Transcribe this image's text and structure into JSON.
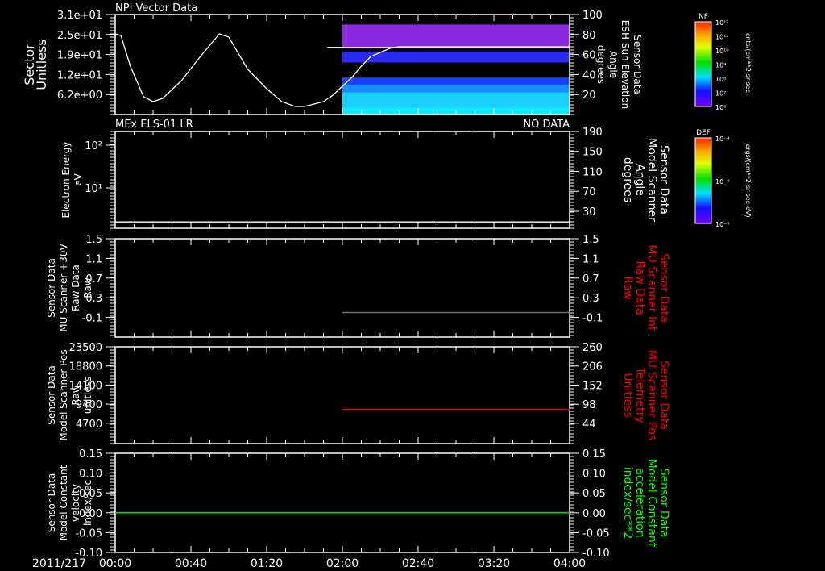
{
  "colors": {
    "background": "#000000",
    "axes": "#ffffff",
    "red_label": "#ff0000",
    "green_label": "#00ff00"
  },
  "time_axis": {
    "date_label": "2011/217",
    "ticks": [
      "00:00",
      "00:40",
      "01:20",
      "02:00",
      "02:40",
      "03:20",
      "04:00"
    ],
    "minutes": [
      0,
      40,
      80,
      120,
      160,
      200,
      240
    ]
  },
  "chart_data": [
    {
      "type": "line",
      "title": "NPI Vector Data",
      "ylabel_lines": [
        "Sector",
        "Unitless"
      ],
      "ylim": [
        0,
        31
      ],
      "yticks": [
        6.2,
        12.4,
        18.6,
        24.8,
        31
      ],
      "ytick_labels": [
        "6.2e+00",
        "1.2e+01",
        "1.9e+01",
        "2.5e+01",
        "3.1e+01"
      ],
      "series": [
        {
          "color": "#ffffff",
          "x_minutes": [
            0,
            3,
            8,
            15,
            20,
            25,
            35,
            45,
            55,
            60,
            70,
            80,
            88,
            95,
            100,
            110,
            115,
            125,
            130,
            135,
            145,
            150,
            240
          ],
          "y": [
            25,
            24.5,
            15,
            5.5,
            4,
            5,
            10.5,
            18,
            25,
            24,
            14,
            8,
            4,
            2.5,
            2.5,
            4,
            6,
            11.5,
            15,
            18,
            20.5,
            21,
            21
          ]
        }
      ],
      "right_axis": {
        "ylabel_lines": [
          "Sensor Data",
          "ESH Sun Elevation",
          "Angle",
          "degrees"
        ],
        "ylim": [
          0,
          100
        ],
        "yticks": [
          20,
          40,
          60,
          80,
          100
        ],
        "ytick_labels": [
          "20",
          "40",
          "60",
          "80",
          "100"
        ]
      },
      "overlay_line": {
        "color": "#ffffff",
        "y_right": 67,
        "start_minutes": 112
      },
      "heatmap": {
        "start_minutes": 120,
        "end_minutes": 240,
        "bands": [
          {
            "from": 66,
            "to": 90,
            "color": "#8a2be2"
          },
          {
            "from": 52,
            "to": 63,
            "color": "#2a2af5"
          },
          {
            "from": 0,
            "to": 37,
            "color": "#1a40ff"
          },
          {
            "from": 0,
            "to": 30,
            "color": "#1a8cff"
          },
          {
            "from": 0,
            "to": 22,
            "color": "#1ad0ff"
          },
          {
            "from": 0,
            "to": 7,
            "color": "#10e8ff"
          }
        ]
      }
    },
    {
      "type": "line",
      "title": "MEx ELS-01 LR",
      "status": "NO DATA",
      "ylabel_lines": [
        "Electron Energy",
        "eV"
      ],
      "yscale": "log",
      "ylim": [
        1.14,
        209
      ],
      "yticks": [
        10,
        100
      ],
      "ytick_labels": [
        "10¹",
        "10²"
      ],
      "series": [
        {
          "color": "#ffffff",
          "x_minutes": [
            0,
            240
          ],
          "y": [
            1.6,
            1.6
          ]
        }
      ],
      "right_axis": {
        "ylabel_lines": [
          "Sensor Data",
          "Model Scanner",
          "Angle",
          "degrees"
        ],
        "ylim": [
          -4,
          190
        ],
        "yticks": [
          30,
          70,
          110,
          150,
          190
        ],
        "ytick_labels": [
          "30",
          "70",
          "110",
          "150",
          "190"
        ]
      }
    },
    {
      "type": "line",
      "ylabel_lines": [
        "Sensor Data",
        "MU Scanner +30V",
        "Raw Data",
        "Raw"
      ],
      "ylim": [
        -0.5,
        1.5
      ],
      "yticks": [
        -0.1,
        0.3,
        0.7,
        1.1,
        1.5
      ],
      "ytick_labels": [
        "-0.1",
        "0.3",
        "0.7",
        "1.1",
        "1.5"
      ],
      "series": [
        {
          "color": "#808080",
          "x_minutes": [
            120,
            240
          ],
          "y": [
            0,
            0
          ]
        }
      ],
      "right_axis": {
        "ylabel_lines": [
          "Sensor Data",
          "MU Scanner Int",
          "Raw Data",
          "Raw"
        ],
        "label_color": "#ff0000",
        "ylim": [
          -0.5,
          1.5
        ],
        "yticks": [
          -0.1,
          0.3,
          0.7,
          1.1,
          1.5
        ],
        "ytick_labels": [
          "-0.1",
          "0.3",
          "0.7",
          "1.1",
          "1.5"
        ]
      }
    },
    {
      "type": "line",
      "ylabel_lines": [
        "Sensor Data",
        "Model Scanner Pos",
        "Raw",
        "unitless"
      ],
      "ylim": [
        -300,
        23500
      ],
      "yticks": [
        4700,
        9400,
        14100,
        18800,
        23500
      ],
      "ytick_labels": [
        "4700",
        "9400",
        "14100",
        "18800",
        "23500"
      ],
      "series": [
        {
          "color": "#ff0000",
          "x_minutes": [
            120,
            240
          ],
          "y": [
            8100,
            8100
          ]
        }
      ],
      "right_axis": {
        "ylabel_lines": [
          "Sensor Data",
          "MU Scanner Pos",
          "Telemetry",
          "Unitless"
        ],
        "label_color": "#ff0000",
        "ylim": [
          -13,
          260
        ],
        "yticks": [
          44,
          98,
          152,
          206,
          260
        ],
        "ytick_labels": [
          "44",
          "98",
          "152",
          "206",
          "260"
        ]
      }
    },
    {
      "type": "line",
      "ylabel_lines": [
        "Sensor Data",
        "Model Constant",
        "velocity",
        "index/sec"
      ],
      "ylim": [
        -0.1,
        0.15
      ],
      "yticks": [
        -0.1,
        -0.05,
        0.0,
        0.05,
        0.1,
        0.15
      ],
      "ytick_labels": [
        "-0.10",
        "-0.05",
        "0.00",
        "0.05",
        "0.10",
        "0.15"
      ],
      "series": [
        {
          "color": "#00ff00",
          "x_minutes": [
            0,
            240
          ],
          "y": [
            0,
            0
          ]
        }
      ],
      "right_axis": {
        "ylabel_lines": [
          "Sensor Data",
          "Model Constant",
          "acceleration",
          "index/sec**2"
        ],
        "label_color": "#00ff00",
        "ylim": [
          -0.1,
          0.15
        ],
        "yticks": [
          -0.1,
          -0.05,
          0.0,
          0.05,
          0.1,
          0.15
        ],
        "ytick_labels": [
          "-0.10",
          "-0.05",
          "0.00",
          "0.05",
          "0.10",
          "0.15"
        ]
      }
    }
  ],
  "colorbars": [
    {
      "title": "NF",
      "tick_labels": [
        "10⁶",
        "10⁷",
        "10⁸",
        "10⁹",
        "10¹⁰",
        "10¹¹",
        "10¹²"
      ],
      "units": "cnts/(cm**2-sr-sec)"
    },
    {
      "title": "DEF",
      "tick_labels": [
        "10⁻⁸",
        "10⁻⁶",
        "10⁻⁴"
      ],
      "units": "ergs/(cm**2-sr-sec-eV)"
    }
  ]
}
